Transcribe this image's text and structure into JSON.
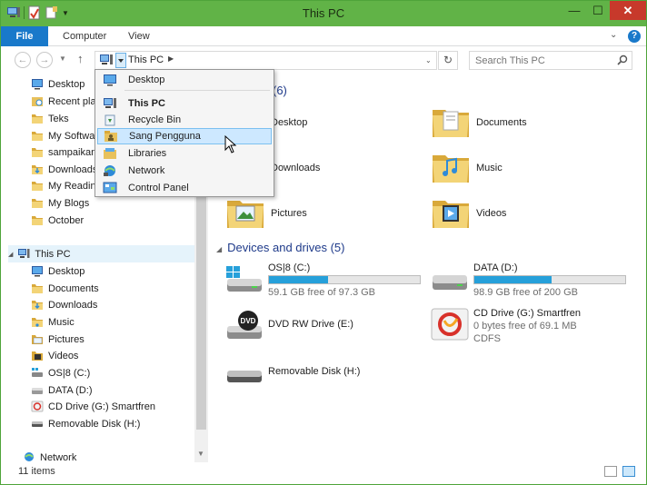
{
  "window": {
    "title": "This PC"
  },
  "titlebar": {
    "min": "—",
    "max": "☐",
    "close": "✕"
  },
  "ribbon": {
    "file": "File",
    "tabs": [
      "Computer",
      "View"
    ],
    "chevron": "⌄",
    "help": "?"
  },
  "nav": {
    "back": "←",
    "forward": "→",
    "recent": "▼",
    "up": "↑",
    "address": "This PC",
    "address_sep": "▶",
    "history": "⌄",
    "refresh": "↻",
    "search_placeholder": "Search This PC"
  },
  "navpane": {
    "quick": [
      "Desktop",
      "Recent places",
      "Teks",
      "My Software",
      "sampaikan",
      "Downloads",
      "My Reading",
      "My Blogs",
      "October"
    ],
    "thispc": "This PC",
    "thispc_items": [
      "Desktop",
      "Documents",
      "Downloads",
      "Music",
      "Pictures",
      "Videos",
      "OS|8 (C:)",
      "DATA (D:)",
      "CD Drive (G:) Smartfren",
      "Removable Disk (H:)"
    ],
    "network": "Network"
  },
  "content": {
    "folders_head_suffix": "(6)",
    "folders": [
      "Desktop",
      "Documents",
      "Downloads",
      "Music",
      "Pictures",
      "Videos"
    ],
    "devices_head": "Devices and drives (5)",
    "drives": [
      {
        "name": "OS|8 (C:)",
        "free": "59.1 GB free of 97.3 GB",
        "fill": 0.39
      },
      {
        "name": "DATA (D:)",
        "free": "98.9 GB free of 200 GB",
        "fill": 0.51
      }
    ],
    "dvd": {
      "name": "DVD RW Drive (E:)"
    },
    "cd": {
      "name": "CD Drive (G:) Smartfren",
      "free": "0 bytes free of 69.1 MB",
      "fs": "CDFS"
    },
    "removable": {
      "name": "Removable Disk (H:)"
    }
  },
  "dropdown": {
    "items": [
      "Desktop",
      "This PC",
      "Recycle Bin",
      "Sang Pengguna",
      "Libraries",
      "Network",
      "Control Panel"
    ]
  },
  "status": {
    "items": "11 items"
  },
  "colors": {
    "titlebar": "#61b347",
    "accent": "#1979ca",
    "bar": "#26a0da",
    "folder": "#e8c15b"
  }
}
